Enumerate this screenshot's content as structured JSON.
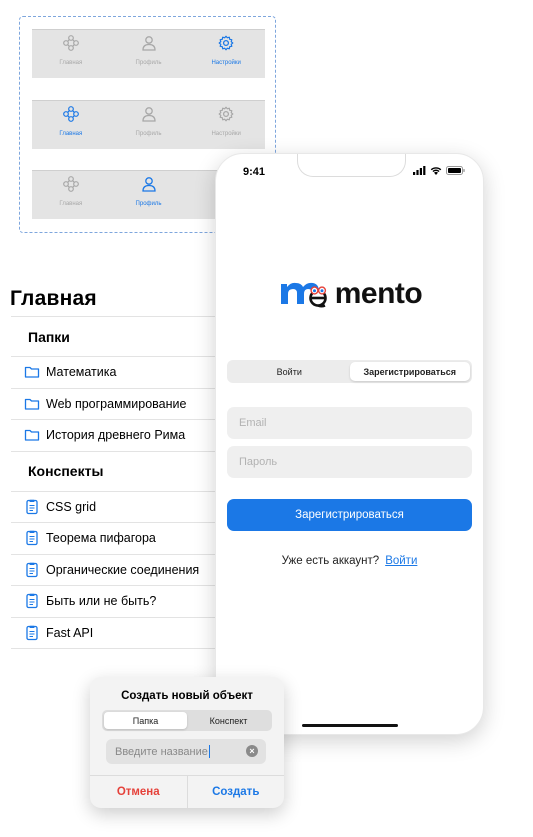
{
  "tabbar_variants": [
    {
      "active": 2,
      "items": [
        {
          "icon": "network-icon",
          "label": "Главная"
        },
        {
          "icon": "person-icon",
          "label": "Профиль"
        },
        {
          "icon": "gear-icon",
          "label": "Настройки"
        }
      ]
    },
    {
      "active": 0,
      "items": [
        {
          "icon": "network-icon",
          "label": "Главная"
        },
        {
          "icon": "person-icon",
          "label": "Профиль"
        },
        {
          "icon": "gear-icon",
          "label": "Настройки"
        }
      ]
    },
    {
      "active": 1,
      "items": [
        {
          "icon": "network-icon",
          "label": "Главная"
        },
        {
          "icon": "person-icon",
          "label": "Профиль"
        },
        {
          "icon": "gear-icon",
          "label": "Н"
        }
      ]
    }
  ],
  "main": {
    "title": "Главная",
    "folders_header": "Папки",
    "folders": [
      "Математика",
      "Web программирование",
      "История древнего Рима"
    ],
    "notes_header": "Конспекты",
    "notes": [
      "CSS grid",
      "Теорема пифагора",
      "Органические соединения",
      "Быть или не быть?",
      "Fast API"
    ]
  },
  "phone": {
    "time": "9:41",
    "logo_text": "mento",
    "tabs": {
      "login": "Войти",
      "register": "Зарегистрироваться",
      "active": "register"
    },
    "email_placeholder": "Email",
    "password_placeholder": "Пароль",
    "submit_label": "Зарегистрироваться",
    "account_prompt": "Уже есть аккаунт?",
    "account_link": "Войти"
  },
  "dialog": {
    "title": "Создать новый объект",
    "seg_folder": "Папка",
    "seg_note": "Конспект",
    "active": "folder",
    "input_placeholder": "Введите название",
    "cancel_label": "Отмена",
    "create_label": "Создать"
  },
  "colors": {
    "accent": "#1b78e6",
    "danger": "#e5413a",
    "inactive": "#a8a8a8"
  }
}
